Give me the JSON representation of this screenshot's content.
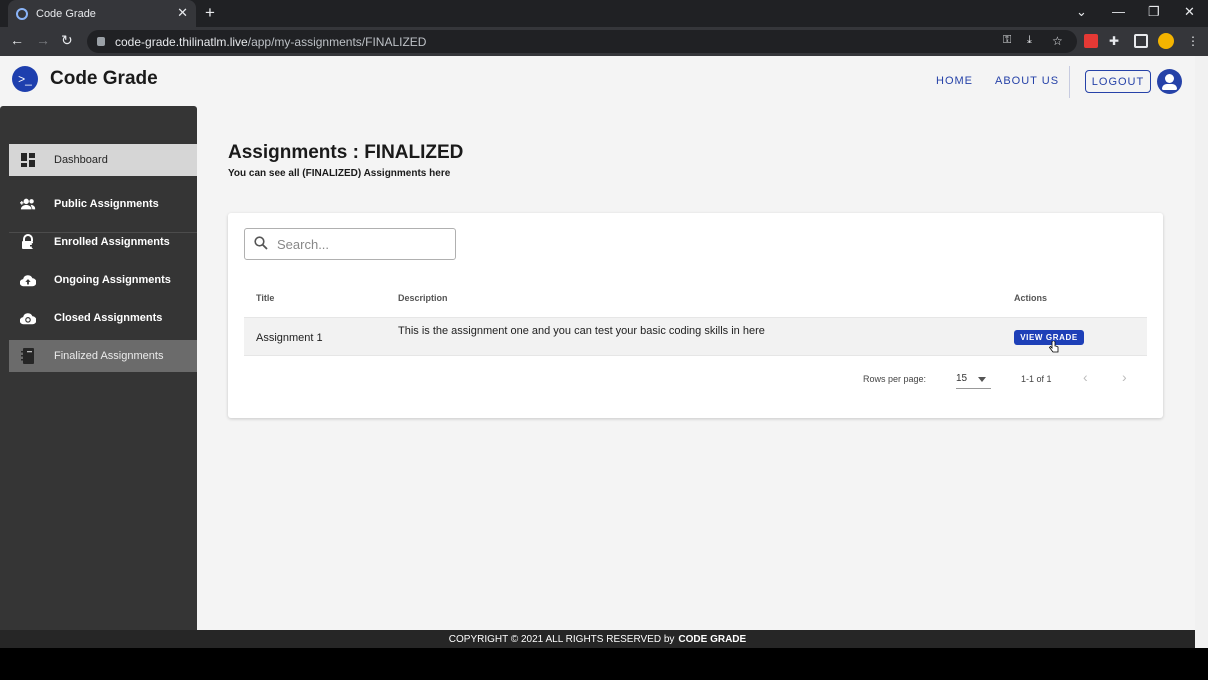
{
  "browser": {
    "tab_title": "Code Grade",
    "url_host": "code-grade.thilinatlm.live",
    "url_path": "/app/my-assignments/FINALIZED"
  },
  "header": {
    "brand": "Code Grade",
    "nav": {
      "home": "HOME",
      "about": "ABOUT US",
      "logout": "LOGOUT"
    }
  },
  "sidebar": {
    "items": [
      {
        "label": "Dashboard",
        "icon": "dashboard-icon"
      },
      {
        "label": "Public Assignments",
        "icon": "group-add-icon"
      },
      {
        "label": "Enrolled Assignments",
        "icon": "lock-plus-icon"
      },
      {
        "label": "Ongoing Assignments",
        "icon": "cloud-upload-icon"
      },
      {
        "label": "Closed Assignments",
        "icon": "cloud-sync-icon"
      },
      {
        "label": "Finalized Assignments",
        "icon": "notebook-icon"
      }
    ]
  },
  "main": {
    "title": "Assignments : FINALIZED",
    "subtitle": "You can see all (FINALIZED) Assignments here",
    "search_placeholder": "Search...",
    "columns": {
      "title": "Title",
      "description": "Description",
      "actions": "Actions"
    },
    "rows": [
      {
        "title": "Assignment 1",
        "description": "This is the assignment one and you can test your basic coding skills in here",
        "action": "VIEW GRADE"
      }
    ],
    "pagination": {
      "rows_per_page_label": "Rows per page:",
      "rows_per_page": "15",
      "range": "1-1 of 1"
    }
  },
  "footer": {
    "text": "COPYRIGHT © 2021 ALL RIGHTS RESERVED by",
    "brand": "CODE GRADE"
  },
  "colors": {
    "primary": "#1e40b8",
    "sidebar": "#353535"
  }
}
